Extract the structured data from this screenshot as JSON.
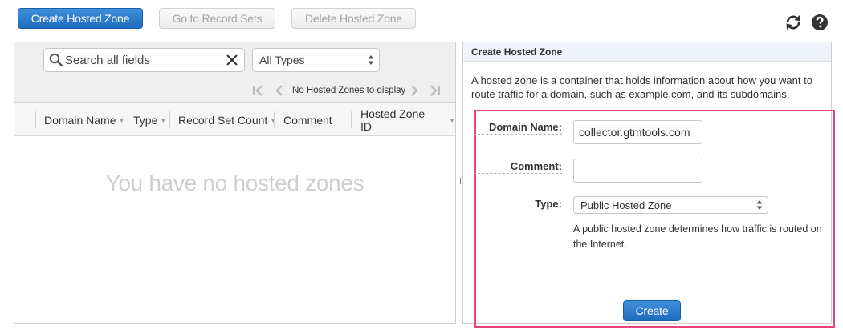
{
  "toolbar": {
    "create_hosted_zone": "Create Hosted Zone",
    "go_to_record_sets": "Go to Record Sets",
    "delete_hosted_zone": "Delete Hosted Zone",
    "refresh_icon": "refresh-icon",
    "help_icon": "help-icon"
  },
  "filter": {
    "search_placeholder": "Search all fields",
    "type_selected": "All Types",
    "pager_text": "No Hosted Zones to display"
  },
  "table": {
    "columns": [
      "Domain Name",
      "Type",
      "Record Set Count",
      "Comment",
      "Hosted Zone ID"
    ],
    "empty_message": "You have no hosted zones"
  },
  "panel": {
    "title": "Create Hosted Zone",
    "description": "A hosted zone is a container that holds information about how you want to route traffic for a domain, such as example.com, and its subdomains.",
    "domain_label": "Domain Name:",
    "domain_value": "collector.gtmtools.com",
    "comment_label": "Comment:",
    "comment_value": "",
    "type_label": "Type:",
    "type_selected": "Public Hosted Zone",
    "type_help": "A public hosted zone determines how traffic is routed on the Internet.",
    "create_button": "Create"
  },
  "colors": {
    "primary_button": "#1f6cbd",
    "highlight_border": "#e8437f",
    "panel_header_bg": "#eef3f9"
  }
}
